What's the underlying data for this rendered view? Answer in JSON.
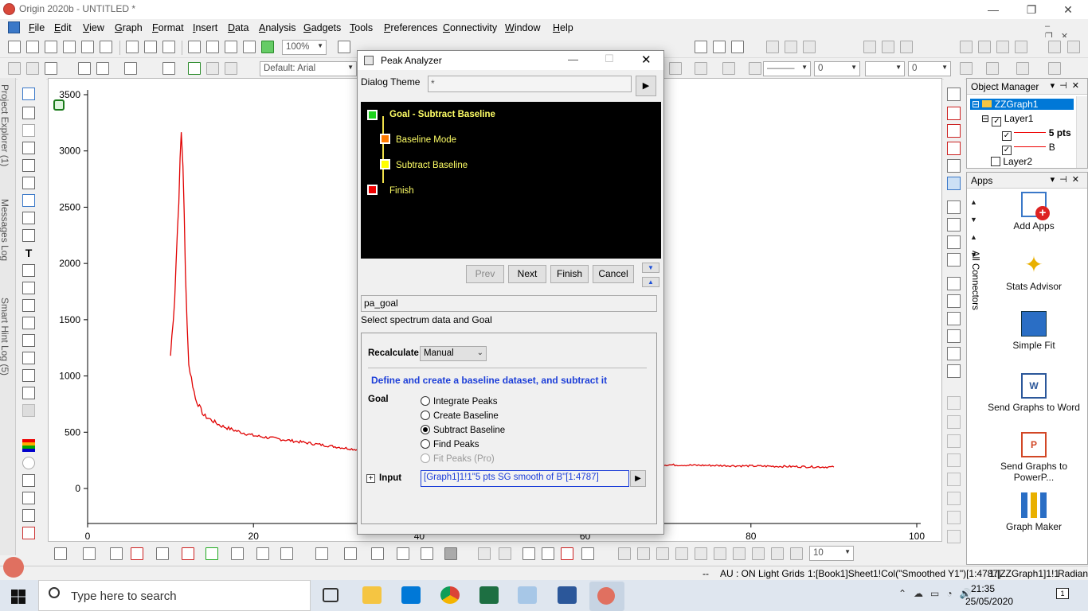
{
  "window": {
    "title": "Origin 2020b - UNTITLED *",
    "min": "—",
    "max": "❐",
    "close": "✕"
  },
  "menu": [
    "File",
    "Edit",
    "View",
    "Graph",
    "Format",
    "Insert",
    "Data",
    "Analysis",
    "Gadgets",
    "Tools",
    "Preferences",
    "Connectivity",
    "Window",
    "Help"
  ],
  "toolbar": {
    "zoom": "100%",
    "font": "Default: Arial",
    "size_a": "0",
    "size_b": "0",
    "bottom_size": "10"
  },
  "left_tabs": [
    "Project Explorer (1)",
    "Messages Log",
    "Smart Hint Log (5)"
  ],
  "graph": {
    "y_ticks": [
      "3500",
      "3000",
      "2500",
      "2000",
      "1500",
      "1000",
      "500",
      "0"
    ],
    "x_ticks": [
      "0",
      "20",
      "40",
      "60",
      "80",
      "100"
    ],
    "series_color": "#e00000"
  },
  "chart_data": {
    "type": "line",
    "xlim": [
      0,
      100
    ],
    "ylim": [
      0,
      3500
    ],
    "series": [
      {
        "x": [
          10,
          10.5,
          11,
          11.3,
          11.5,
          11.8,
          12.2,
          13,
          14,
          16,
          18,
          20,
          24,
          28,
          32,
          36,
          40,
          45,
          50,
          55,
          60,
          65,
          70,
          75,
          80,
          85,
          90
        ],
        "y": [
          1180,
          1700,
          2600,
          3150,
          2900,
          1900,
          1100,
          800,
          650,
          560,
          510,
          470,
          430,
          390,
          350,
          320,
          300,
          270,
          250,
          235,
          225,
          215,
          210,
          205,
          200,
          195,
          190
        ]
      }
    ]
  },
  "status": {
    "dashes": "--",
    "au": "AU : ON",
    "grids": "Light Grids",
    "col": "1:[Book1]Sheet1!Col(\"Smoothed Y1\")[1:4787]",
    "graph": "1:[ZZGraph1]1!1",
    "unit": "Radian"
  },
  "taskbar": {
    "search_placeholder": "Type here to search",
    "time": "21:35",
    "date": "25/05/2020",
    "notif": "1"
  },
  "object_manager": {
    "title": "Object Manager",
    "graph": "ZZGraph1",
    "layer1": "Layer1",
    "plot1": "5 pts",
    "plot2": "B",
    "layer2": "Layer2"
  },
  "apps": {
    "title": "Apps",
    "side_tabs": "All  Connectors",
    "items": [
      {
        "label": "Add Apps"
      },
      {
        "label": "Stats Advisor"
      },
      {
        "label": "Simple Fit"
      },
      {
        "label": "Send Graphs to Word"
      },
      {
        "label": "Send Graphs to PowerP..."
      },
      {
        "label": "Graph Maker"
      }
    ]
  },
  "dialog": {
    "title": "Peak Analyzer",
    "theme_label": "Dialog Theme",
    "theme_value": "*",
    "flow": {
      "goal": "Goal - Subtract Baseline",
      "baseline_mode": "Baseline Mode",
      "subtract": "Subtract Baseline",
      "finish": "Finish"
    },
    "buttons": {
      "prev": "Prev",
      "next": "Next",
      "finish": "Finish",
      "cancel": "Cancel"
    },
    "page_name": "pa_goal",
    "page_hint": "Select spectrum data and Goal",
    "recalc_label": "Recalculate",
    "recalc_value": "Manual",
    "description": "Define and create a baseline dataset, and subtract it",
    "goal_label": "Goal",
    "goals": [
      "Integrate Peaks",
      "Create Baseline",
      "Subtract Baseline",
      "Find Peaks",
      "Fit Peaks (Pro)"
    ],
    "input_label": "Input",
    "input_value": "[Graph1]1!1\"5 pts SG smooth of B\"[1:4787]"
  }
}
